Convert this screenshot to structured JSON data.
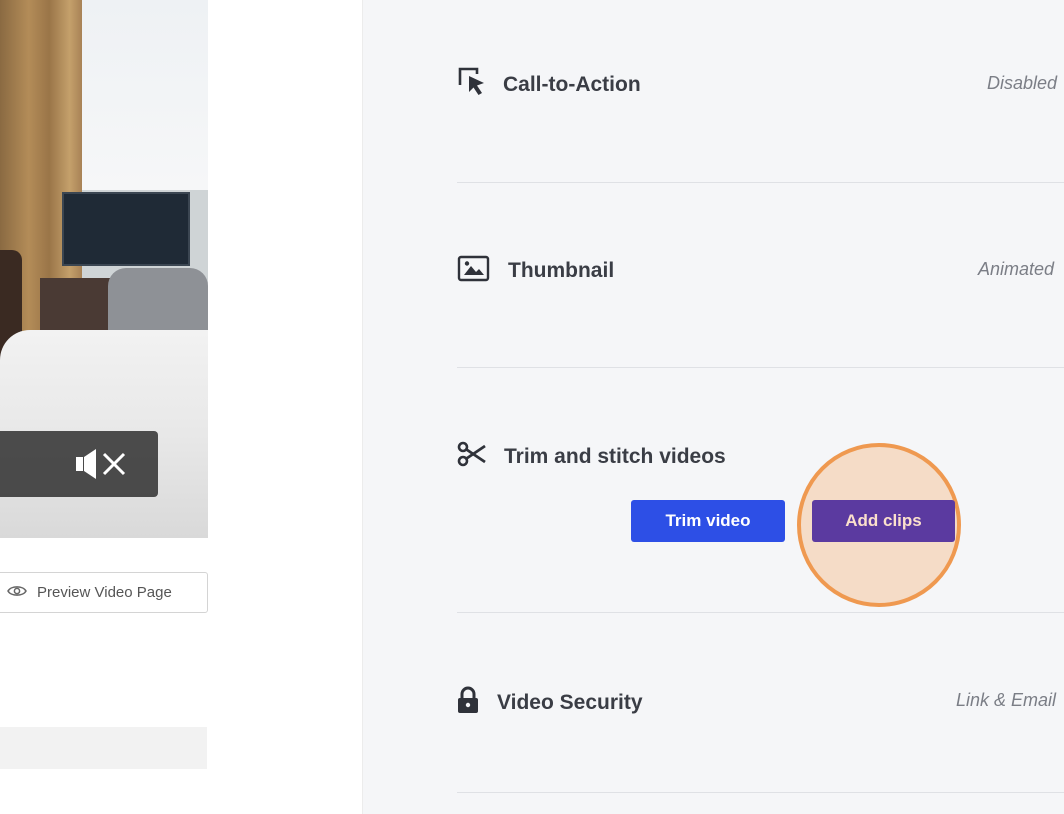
{
  "video": {
    "mute_icon": "speaker-muted-icon"
  },
  "preview": {
    "label": "Preview Video Page",
    "icon": "eye-icon"
  },
  "settings": {
    "cta": {
      "title": "Call-to-Action",
      "status": "Disabled",
      "icon": "cursor-select-icon"
    },
    "thumbnail": {
      "title": "Thumbnail",
      "status": "Animated",
      "icon": "image-icon"
    },
    "trim": {
      "title": "Trim and stitch videos",
      "icon": "scissors-icon",
      "trim_label": "Trim video",
      "add_clips_label": "Add clips"
    },
    "security": {
      "title": "Video Security",
      "status": "Link & Email",
      "icon": "lock-icon"
    }
  },
  "colors": {
    "trim_button": "#2d4fe6",
    "add_clips_button": "#5b3aa0",
    "highlight_ring": "#ef9950",
    "panel_background": "#f5f6f8"
  }
}
